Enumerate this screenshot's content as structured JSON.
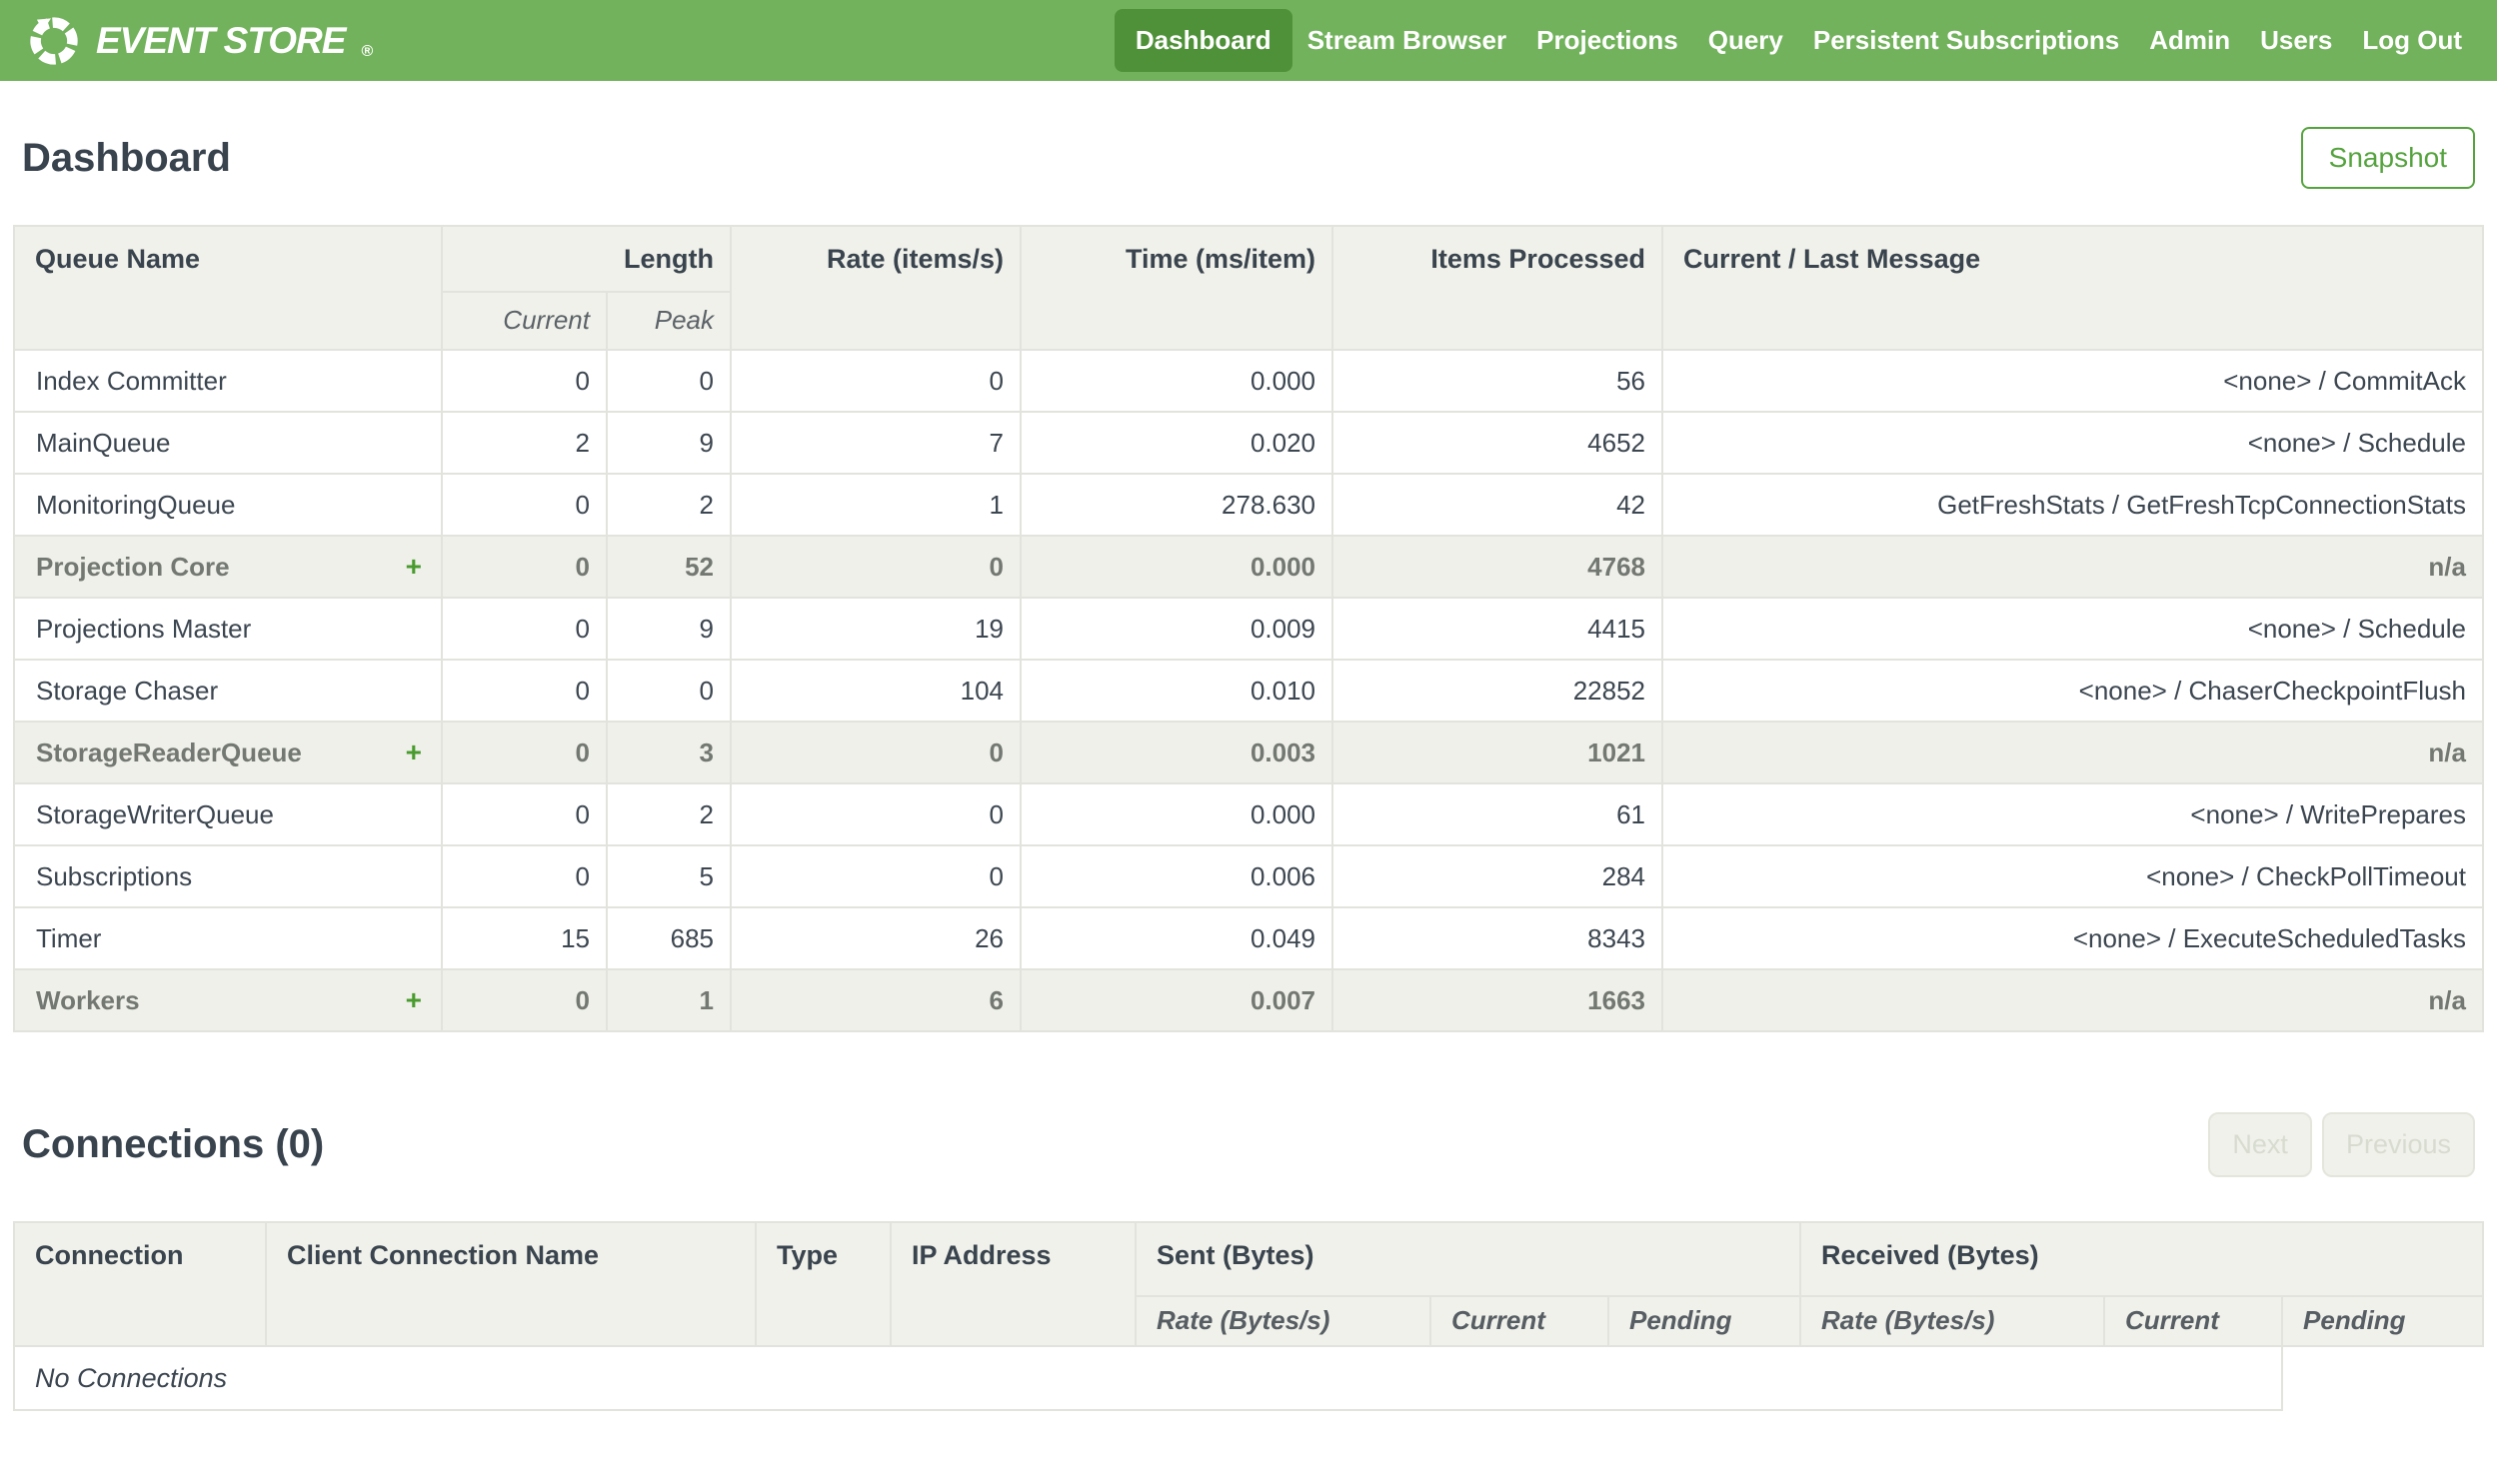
{
  "nav": {
    "brand": "EVENT STORE",
    "brand_mark": "®",
    "items": [
      {
        "label": "Dashboard",
        "active": true
      },
      {
        "label": "Stream Browser",
        "active": false
      },
      {
        "label": "Projections",
        "active": false
      },
      {
        "label": "Query",
        "active": false
      },
      {
        "label": "Persistent Subscriptions",
        "active": false
      },
      {
        "label": "Admin",
        "active": false
      },
      {
        "label": "Users",
        "active": false
      },
      {
        "label": "Log Out",
        "active": false
      }
    ]
  },
  "page": {
    "title": "Dashboard",
    "snapshot_button": "Snapshot"
  },
  "queues": {
    "headers": {
      "queue_name": "Queue Name",
      "length": "Length",
      "current": "Current",
      "peak": "Peak",
      "rate": "Rate (items/s)",
      "time": "Time (ms/item)",
      "items_processed": "Items Processed",
      "message": "Current / Last Message"
    },
    "rows": [
      {
        "name": "Index Committer",
        "expand": "",
        "group": false,
        "current": "0",
        "peak": "0",
        "rate": "0",
        "time": "0.000",
        "items": "56",
        "message": "<none> / CommitAck"
      },
      {
        "name": "MainQueue",
        "expand": "",
        "group": false,
        "current": "2",
        "peak": "9",
        "rate": "7",
        "time": "0.020",
        "items": "4652",
        "message": "<none> / Schedule"
      },
      {
        "name": "MonitoringQueue",
        "expand": "",
        "group": false,
        "current": "0",
        "peak": "2",
        "rate": "1",
        "time": "278.630",
        "items": "42",
        "message": "GetFreshStats / GetFreshTcpConnectionStats"
      },
      {
        "name": "Projection Core",
        "expand": "+",
        "group": true,
        "current": "0",
        "peak": "52",
        "rate": "0",
        "time": "0.000",
        "items": "4768",
        "message": "n/a"
      },
      {
        "name": "Projections Master",
        "expand": "",
        "group": false,
        "current": "0",
        "peak": "9",
        "rate": "19",
        "time": "0.009",
        "items": "4415",
        "message": "<none> / Schedule"
      },
      {
        "name": "Storage Chaser",
        "expand": "",
        "group": false,
        "current": "0",
        "peak": "0",
        "rate": "104",
        "time": "0.010",
        "items": "22852",
        "message": "<none> / ChaserCheckpointFlush"
      },
      {
        "name": "StorageReaderQueue",
        "expand": "+",
        "group": true,
        "current": "0",
        "peak": "3",
        "rate": "0",
        "time": "0.003",
        "items": "1021",
        "message": "n/a"
      },
      {
        "name": "StorageWriterQueue",
        "expand": "",
        "group": false,
        "current": "0",
        "peak": "2",
        "rate": "0",
        "time": "0.000",
        "items": "61",
        "message": "<none> / WritePrepares"
      },
      {
        "name": "Subscriptions",
        "expand": "",
        "group": false,
        "current": "0",
        "peak": "5",
        "rate": "0",
        "time": "0.006",
        "items": "284",
        "message": "<none> / CheckPollTimeout"
      },
      {
        "name": "Timer",
        "expand": "",
        "group": false,
        "current": "15",
        "peak": "685",
        "rate": "26",
        "time": "0.049",
        "items": "8343",
        "message": "<none> / ExecuteScheduledTasks"
      },
      {
        "name": "Workers",
        "expand": "+",
        "group": true,
        "current": "0",
        "peak": "1",
        "rate": "6",
        "time": "0.007",
        "items": "1663",
        "message": "n/a"
      }
    ]
  },
  "connections": {
    "title": "Connections (0)",
    "next_button": "Next",
    "previous_button": "Previous",
    "headers": {
      "connection": "Connection",
      "client_connection_name": "Client Connection Name",
      "type": "Type",
      "ip_address": "IP Address",
      "sent": "Sent (Bytes)",
      "received": "Received (Bytes)",
      "rate": "Rate (Bytes/s)",
      "current": "Current",
      "pending": "Pending"
    },
    "empty_message": "No Connections"
  },
  "colors": {
    "nav_green": "#72b25c",
    "nav_active_green": "#4f9138",
    "accent_green": "#55a33e",
    "header_bg": "#f0f1ea",
    "group_row_bg": "#eff0e9",
    "text_dark": "#3c4650",
    "group_text_gray": "#737873",
    "border": "#e3e3dd"
  }
}
